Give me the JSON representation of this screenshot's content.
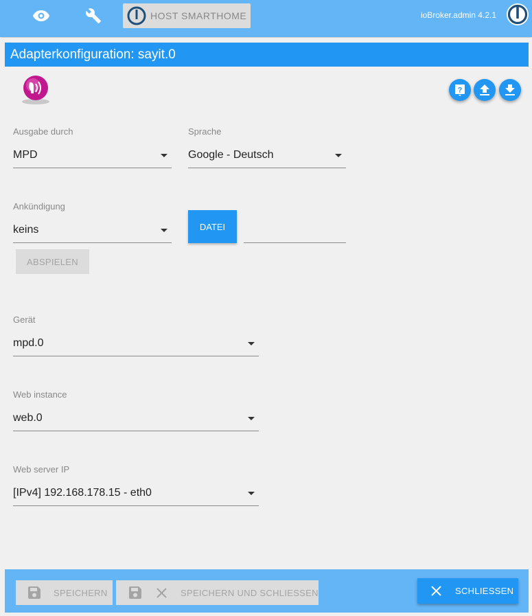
{
  "header": {
    "eye_icon": "eye-icon",
    "wrench_icon": "wrench-icon",
    "host_label": "HOST SMARTHOME",
    "version": "ioBroker.admin 4.2.1"
  },
  "title": "Adapterkonfiguration: sayit.0",
  "toolbar_icons": [
    "help-icon",
    "upload-icon",
    "download-icon"
  ],
  "fields": {
    "output": {
      "label": "Ausgabe durch",
      "value": "MPD"
    },
    "language": {
      "label": "Sprache",
      "value": "Google - Deutsch"
    },
    "announce": {
      "label": "Ankündigung",
      "value": "keins"
    },
    "file_button": "DATEI",
    "play_button": "ABSPIELEN",
    "device": {
      "label": "Gerät",
      "value": "mpd.0"
    },
    "web_instance": {
      "label": "Web instance",
      "value": "web.0"
    },
    "web_server_ip": {
      "label": "Web server IP",
      "value": "[IPv4] 192.168.178.15 - eth0"
    }
  },
  "footer": {
    "save": "SPEICHERN",
    "save_close": "SPEICHERN UND SCHLIESSEN",
    "close": "SCHLIESSEN"
  },
  "colors": {
    "accent": "#2196f3",
    "bar": "#64b5f6",
    "background": "#f0f0f0",
    "disabled": "#dcdcdc"
  }
}
